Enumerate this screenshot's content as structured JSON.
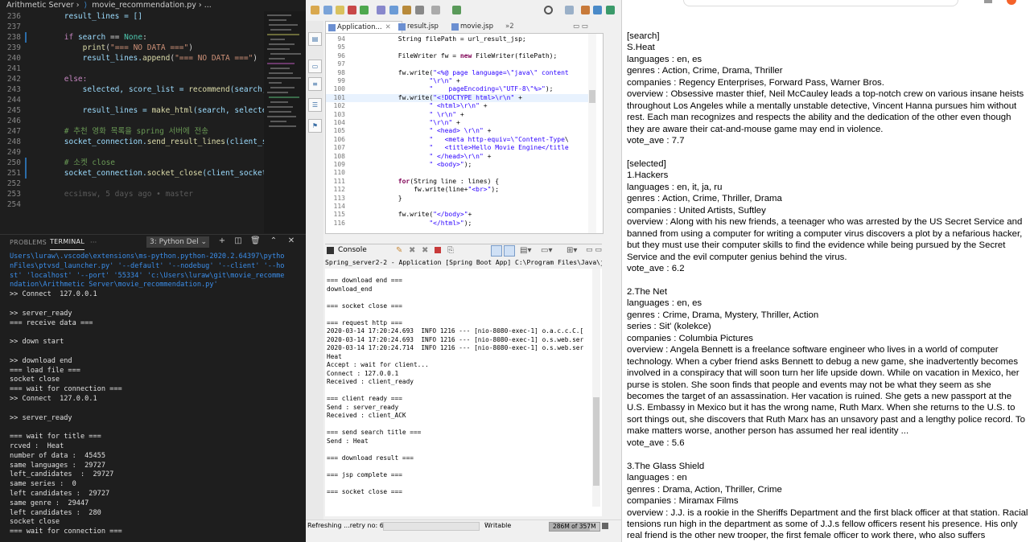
{
  "vscode": {
    "breadcrumb": {
      "folder": "Arithmetic Server",
      "file": "movie_recommendation.py",
      "tail": "..."
    },
    "editor_lines": [
      {
        "num": "236",
        "kind": "assign_list"
      },
      {
        "num": "237",
        "kind": "blank"
      },
      {
        "num": "238",
        "kind": "if_none"
      },
      {
        "num": "239",
        "kind": "print_nodata"
      },
      {
        "num": "240",
        "kind": "append_nodata"
      },
      {
        "num": "241",
        "kind": "blank"
      },
      {
        "num": "242",
        "kind": "else"
      },
      {
        "num": "243",
        "kind": "recommend"
      },
      {
        "num": "244",
        "kind": "blank"
      },
      {
        "num": "245",
        "kind": "make_html"
      },
      {
        "num": "246",
        "kind": "blank"
      },
      {
        "num": "247",
        "kind": "comment_spring"
      },
      {
        "num": "248",
        "kind": "send_result"
      },
      {
        "num": "249",
        "kind": "blank"
      },
      {
        "num": "250",
        "kind": "comment_socket"
      },
      {
        "num": "251",
        "kind": "socket_close"
      },
      {
        "num": "252",
        "kind": "blank"
      },
      {
        "num": "253",
        "kind": "blame"
      },
      {
        "num": "254",
        "kind": "blank"
      }
    ],
    "code": {
      "l236": "result_lines = []",
      "l238_if": "if",
      "l238_var": "search",
      "l238_rest": " == ",
      "l238_none": "None",
      "l239_fn": "print",
      "l239_str": "\"=== NO DATA ===\"",
      "l240_a": "result_lines.",
      "l240_fn": "append",
      "l240_str": "\"=== NO DATA ===\"",
      "l242": "else:",
      "l243_a": "selected, score_list = ",
      "l243_fn": "recommend",
      "l243_b": "(search,",
      "l245_a": "result_lines = ",
      "l245_fn": "make_html",
      "l245_b": "(search, selected",
      "l247": "# 추천 영화 목록을 spring 서버에 전송",
      "l248_a": "socket_connection.",
      "l248_fn": "send_result_lines",
      "l248_b": "(client_so",
      "l250": "# 소켓 close",
      "l251_a": "socket_connection.",
      "l251_fn": "socket_close",
      "l251_b": "(client_socket)",
      "l253": "ecsimsw, 5 days ago • master"
    },
    "panel": {
      "tab_problems": "PROBLEMS",
      "tab_terminal": "TERMINAL",
      "tab_more": "···",
      "terminal_select": "3: Python Del"
    },
    "terminal_lines": [
      {
        "text": "Users\\luraw\\.vscode\\extensions\\ms-python.python-2020.2.64397\\pytho",
        "color": "blue"
      },
      {
        "text": "nFiles\\ptvsd_launcher.py' '--default' '--nodebug' '--client' '--ho",
        "color": "blue"
      },
      {
        "text": "st' 'localhost' '--port' '55334' 'c:\\Users\\luraw\\git\\movie_recomme",
        "color": "blue"
      },
      {
        "text": "ndation\\Arithmetic Server\\movie_recommendation.py'",
        "color": "blue"
      },
      {
        "text": ">> Connect  127.0.0.1",
        "color": "white"
      },
      {
        "text": "",
        "color": "white"
      },
      {
        "text": ">> server_ready",
        "color": "white"
      },
      {
        "text": "=== receive data ===",
        "color": "white"
      },
      {
        "text": "",
        "color": "white"
      },
      {
        "text": ">> down start",
        "color": "white"
      },
      {
        "text": "",
        "color": "white"
      },
      {
        "text": ">> download end",
        "color": "white"
      },
      {
        "text": "=== load file ===",
        "color": "white"
      },
      {
        "text": "socket close",
        "color": "white"
      },
      {
        "text": "=== wait for connection ===",
        "color": "white"
      },
      {
        "text": ">> Connect  127.0.0.1",
        "color": "white"
      },
      {
        "text": "",
        "color": "white"
      },
      {
        "text": ">> server_ready",
        "color": "white"
      },
      {
        "text": "",
        "color": "white"
      },
      {
        "text": "=== wait for title ===",
        "color": "white"
      },
      {
        "text": "rcved :  Heat",
        "color": "white"
      },
      {
        "text": "number of data :  45455",
        "color": "white"
      },
      {
        "text": "same languages :  29727",
        "color": "white"
      },
      {
        "text": "left_candidates  :  29727",
        "color": "white"
      },
      {
        "text": "same series :  0",
        "color": "white"
      },
      {
        "text": "left candidates :  29727",
        "color": "white"
      },
      {
        "text": "same genre :  29447",
        "color": "white"
      },
      {
        "text": "left candidates :  280",
        "color": "white"
      },
      {
        "text": "socket close",
        "color": "white"
      },
      {
        "text": "=== wait for connection ===",
        "color": "white"
      }
    ]
  },
  "eclipse": {
    "tabs": [
      {
        "label": "Application...",
        "active": true
      },
      {
        "label": "result.jsp",
        "active": false
      },
      {
        "label": "movie.jsp",
        "active": false
      }
    ],
    "tab_overflow": "»2",
    "editor_lines": [
      {
        "num": "94",
        "text": "            String filePath = url_result_jsp;"
      },
      {
        "num": "95",
        "text": ""
      },
      {
        "num": "96",
        "text": "            FileWriter fw = new FileWriter(filePath);"
      },
      {
        "num": "97",
        "text": ""
      },
      {
        "num": "98",
        "text": "            fw.write(\"<%@ page language=\\\"java\\\" content"
      },
      {
        "num": "99",
        "text": "                    \"\\r\\n\" +"
      },
      {
        "num": "100",
        "text": "                    \"    pageEncoding=\\\"UTF-8\\\"%>\");"
      },
      {
        "num": "101",
        "text": "            fw.write(\"<!DOCTYPE html>\\r\\n\" +"
      },
      {
        "num": "102",
        "text": "                    \" <html>\\r\\n\" +"
      },
      {
        "num": "103",
        "text": "                    \" \\r\\n\" +"
      },
      {
        "num": "104",
        "text": "                    \"\\r\\n\" +"
      },
      {
        "num": "105",
        "text": "                    \" <head> \\r\\n\" +"
      },
      {
        "num": "106",
        "text": "                    \"   <meta http-equiv=\\\"Content-Type\\"
      },
      {
        "num": "107",
        "text": "                    \"   <title>Hello Movie Engine</title"
      },
      {
        "num": "108",
        "text": "                    \" </head>\\r\\n\" +"
      },
      {
        "num": "109",
        "text": "                    \" <body>\");"
      },
      {
        "num": "110",
        "text": ""
      },
      {
        "num": "111",
        "text": "            for(String line : lines) {"
      },
      {
        "num": "112",
        "text": "                fw.write(line+\"<br>\");"
      },
      {
        "num": "113",
        "text": "            }"
      },
      {
        "num": "114",
        "text": ""
      },
      {
        "num": "115",
        "text": "            fw.write(\"</body>\"+"
      },
      {
        "num": "116",
        "text": "                    \"</html>\");"
      }
    ],
    "console_title": "Console",
    "console_sub": "Spring_server2-2 - Application [Spring Boot App] C:\\Program Files\\Java\\jdk-13.0.2\\bin\\",
    "console_lines": [
      "=== download end ===",
      "download_end",
      "",
      "=== socket close ===",
      "",
      "=== request http ===",
      "2020-03-14 17:20:24.693  INFO 1216 --- [nio-8080-exec-1] o.a.c.c.C.[",
      "2020-03-14 17:20:24.693  INFO 1216 --- [nio-8080-exec-1] o.s.web.ser",
      "2020-03-14 17:20:24.714  INFO 1216 --- [nio-8080-exec-1] o.s.web.ser",
      "Heat",
      "Accept : wait for client...",
      "Connect : 127.0.0.1",
      "Received : client_ready",
      "",
      "=== client ready ===",
      "Send : server_ready",
      "Received : client_ACK",
      "",
      "=== send search title ===",
      "Send : Heat",
      "",
      "=== download result ===",
      "",
      "=== jsp complete ===",
      "",
      "=== socket close ==="
    ],
    "status": {
      "refreshing": "Refreshing ...retry no: 6",
      "mode": "Writable",
      "memory": "286M of 357M"
    }
  },
  "browser": {
    "blocks": [
      [
        "[search]",
        "S.Heat",
        "languages : en, es",
        "genres : Action, Crime, Drama, Thriller",
        "companies : Regency Enterprises, Forward Pass, Warner Bros.",
        "overview : Obsessive master thief, Neil McCauley leads a top-notch crew on various insane heists throughout Los Angeles while a mentally unstable detective, Vincent Hanna pursues him without rest. Each man recognizes and respects the ability and the dedication of the other even though they are aware their cat-and-mouse game may end in violence.",
        "vote_ave : 7.7"
      ],
      [
        "[selected]",
        "1.Hackers",
        "languages : en, it, ja, ru",
        "genres : Action, Crime, Thriller, Drama",
        "companies : United Artists, Suftley",
        "overview : Along with his new friends, a teenager who was arrested by the US Secret Service and banned from using a computer for writing a computer virus discovers a plot by a nefarious hacker, but they must use their computer skills to find the evidence while being pursued by the Secret Service and the evil computer genius behind the virus.",
        "vote_ave : 6.2"
      ],
      [
        "2.The Net",
        "languages : en, es",
        "genres : Crime, Drama, Mystery, Thriller, Action",
        "series : Sit' (kolekce)",
        "companies : Columbia Pictures",
        "overview : Angela Bennett is a freelance software engineer who lives in a world of computer technology. When a cyber friend asks Bennett to debug a new game, she inadvertently becomes involved in a conspiracy that will soon turn her life upside down. While on vacation in Mexico, her purse is stolen. She soon finds that people and events may not be what they seem as she becomes the target of an assassination. Her vacation is ruined. She gets a new passport at the U.S. Embassy in Mexico but it has the wrong name, Ruth Marx. When she returns to the U.S. to sort things out, she discovers that Ruth Marx has an unsavory past and a lengthy police record. To make matters worse, another person has assumed her real identity ...",
        "vote_ave : 5.6"
      ],
      [
        "3.The Glass Shield",
        "languages : en",
        "genres : Drama, Action, Thriller, Crime",
        "companies : Miramax Films",
        "overview : J.J. is a rookie in the Sheriffs Department and the first black officer at that station. Racial tensions run high in the department as some of J.J.s fellow officers resent his presence. His only real friend is the other new trooper, the first female officer to work there, who also suffers"
      ]
    ]
  },
  "colors": {
    "vscode_bg": "#1e1e1e",
    "terminal_blue": "#3b8eea",
    "eclipse_keyword": "#7f0055",
    "eclipse_string": "#2a00ff"
  }
}
